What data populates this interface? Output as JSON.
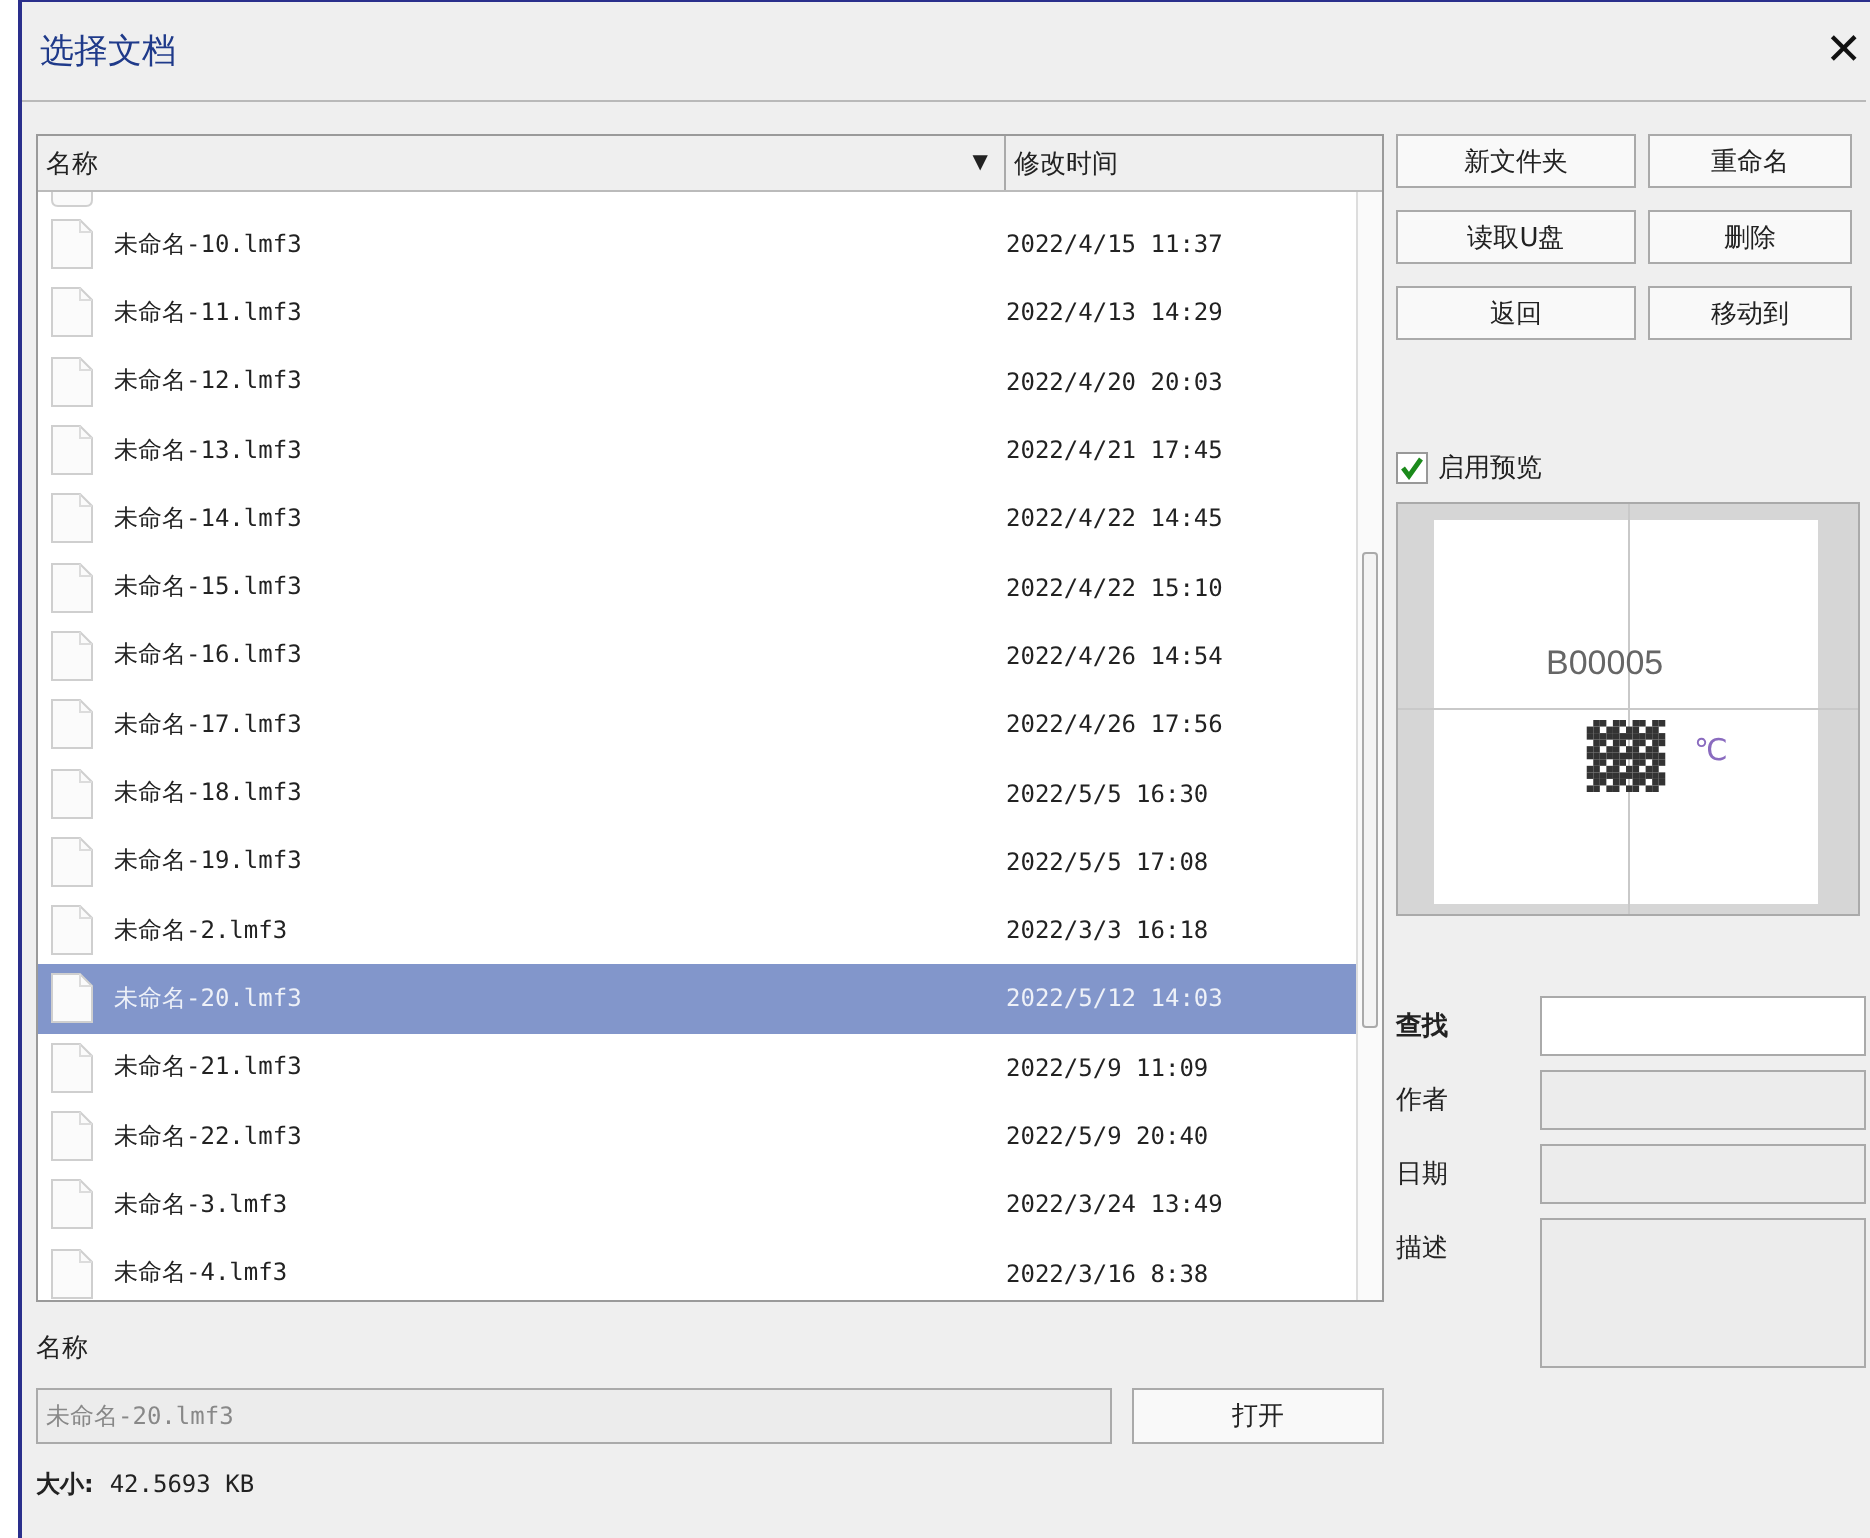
{
  "window": {
    "title": "选择文档",
    "close": "✕"
  },
  "file_list": {
    "columns": [
      {
        "label": "名称",
        "sort_indicator": "▼"
      },
      {
        "label": "修改时间"
      }
    ],
    "rows": [
      {
        "name": "未命名-10.lmf3",
        "modified": "2022/4/15 11:37",
        "selected": false
      },
      {
        "name": "未命名-11.lmf3",
        "modified": "2022/4/13 14:29",
        "selected": false
      },
      {
        "name": "未命名-12.lmf3",
        "modified": "2022/4/20 20:03",
        "selected": false
      },
      {
        "name": "未命名-13.lmf3",
        "modified": "2022/4/21 17:45",
        "selected": false
      },
      {
        "name": "未命名-14.lmf3",
        "modified": "2022/4/22 14:45",
        "selected": false
      },
      {
        "name": "未命名-15.lmf3",
        "modified": "2022/4/22 15:10",
        "selected": false
      },
      {
        "name": "未命名-16.lmf3",
        "modified": "2022/4/26 14:54",
        "selected": false
      },
      {
        "name": "未命名-17.lmf3",
        "modified": "2022/4/26 17:56",
        "selected": false
      },
      {
        "name": "未命名-18.lmf3",
        "modified": "2022/5/5 16:30",
        "selected": false
      },
      {
        "name": "未命名-19.lmf3",
        "modified": "2022/5/5 17:08",
        "selected": false
      },
      {
        "name": "未命名-2.lmf3",
        "modified": "2022/3/3 16:18",
        "selected": false
      },
      {
        "name": "未命名-20.lmf3",
        "modified": "2022/5/12 14:03",
        "selected": true
      },
      {
        "name": "未命名-21.lmf3",
        "modified": "2022/5/9 11:09",
        "selected": false
      },
      {
        "name": "未命名-22.lmf3",
        "modified": "2022/5/9 20:40",
        "selected": false
      },
      {
        "name": "未命名-3.lmf3",
        "modified": "2022/3/24 13:49",
        "selected": false
      },
      {
        "name": "未命名-4.lmf3",
        "modified": "2022/3/16 8:38",
        "selected": false
      }
    ]
  },
  "buttons": [
    "新文件夹",
    "重命名",
    "读取U盘",
    "删除",
    "返回",
    "移动到"
  ],
  "preview": {
    "label": "启用预览",
    "checked": true,
    "label_text": "B00005",
    "unit": "℃"
  },
  "properties": [
    {
      "label": "查找",
      "kind": "search"
    },
    {
      "label": "作者",
      "kind": "readonly"
    },
    {
      "label": "日期",
      "kind": "readonly"
    },
    {
      "label": "描述",
      "kind": "multiline"
    }
  ],
  "name_field": {
    "label": "名称",
    "value": "未命名-20.lmf3"
  },
  "open_button": "打开",
  "size": {
    "label": "大小:",
    "value": "42.5693 KB"
  }
}
